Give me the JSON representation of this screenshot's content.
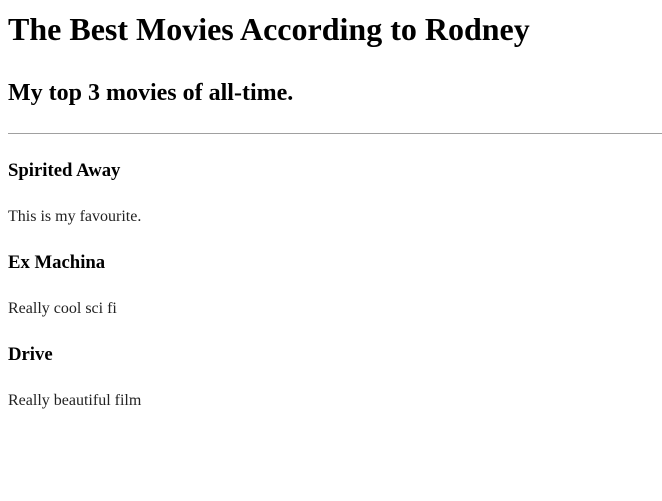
{
  "title": "The Best Movies According to Rodney",
  "subtitle": "My top 3 movies of all-time.",
  "movies": [
    {
      "name": "Spirited Away",
      "description": "This is my favourite."
    },
    {
      "name": "Ex Machina",
      "description": "Really cool sci fi"
    },
    {
      "name": "Drive",
      "description": "Really beautiful film"
    }
  ]
}
